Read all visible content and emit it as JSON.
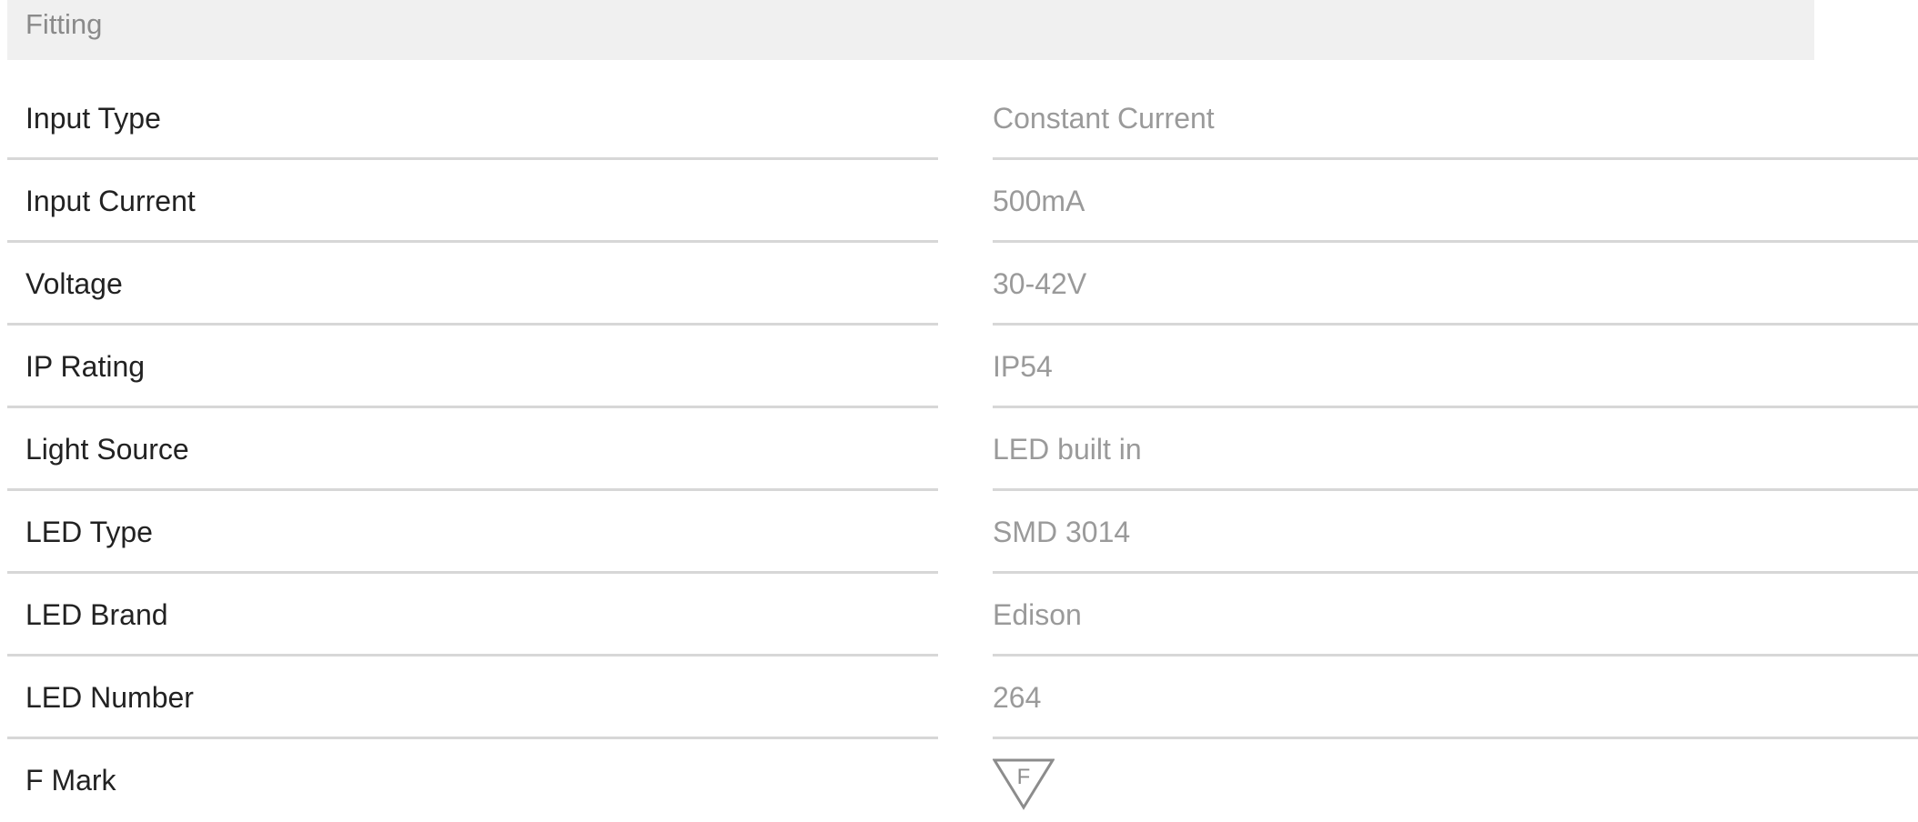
{
  "section": {
    "title": "Fitting"
  },
  "specs": [
    {
      "label": "Input Type",
      "value": "Constant Current"
    },
    {
      "label": "Input Current",
      "value": "500mA"
    },
    {
      "label": "Voltage",
      "value": "30-42V"
    },
    {
      "label": "IP Rating",
      "value": "IP54"
    },
    {
      "label": "Light Source",
      "value": "LED built in"
    },
    {
      "label": "LED Type",
      "value": "SMD 3014"
    },
    {
      "label": "LED Brand",
      "value": "Edison"
    },
    {
      "label": "LED Number",
      "value": "264"
    },
    {
      "label": "F Mark",
      "icon": "f-mark-icon",
      "icon_letter": "F"
    }
  ]
}
